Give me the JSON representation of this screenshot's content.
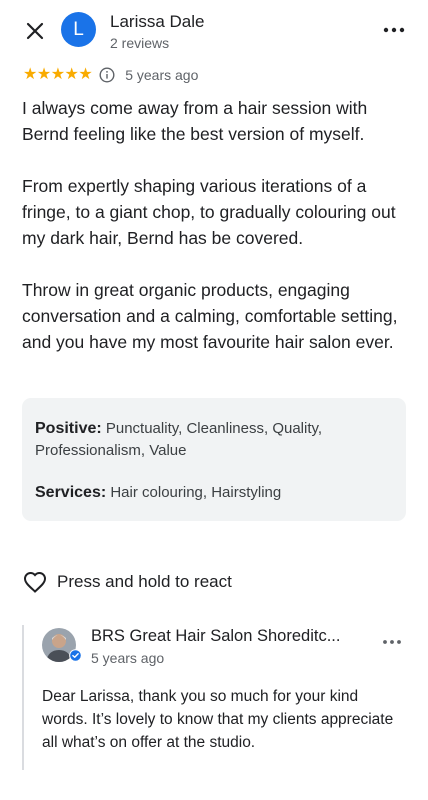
{
  "header": {
    "avatar_letter": "L",
    "reviewer_name": "Larissa Dale",
    "review_count": "2 reviews",
    "avatar_color": "#1a73e8"
  },
  "review": {
    "rating": 5,
    "stars": "★★★★★",
    "time": "5 years ago",
    "paragraphs": [
      "I always come away from a hair session with Bernd feeling like the best version of myself.",
      "From expertly shaping various iterations of a fringe, to a giant chop, to gradually colouring out my dark hair, Bernd has be covered.",
      "Throw in great organic products, engaging conversation and a calming, comfortable setting, and you have my most favourite hair salon ever."
    ]
  },
  "tags": {
    "positive_label": "Positive:",
    "positive_value": "Punctuality, Cleanliness, Quality, Professionalism, Value",
    "services_label": "Services:",
    "services_value": "Hair colouring, Hairstyling"
  },
  "react": {
    "label": "Press and hold to react"
  },
  "owner_reply": {
    "name": "BRS Great Hair Salon Shoreditc...",
    "time": "5 years ago",
    "text": "Dear Larissa, thank you so much for your kind words. It’s lovely to know that my clients appreciate all what’s on offer at the studio."
  },
  "colors": {
    "star": "#f9ab00",
    "tag_background": "#f1f3f4",
    "verified_badge": "#1a73e8"
  },
  "icons": {
    "close": "close-icon",
    "more": "more-horizontal-icon",
    "info": "info-icon",
    "heart": "heart-outline-icon",
    "verified": "verified-badge-icon"
  }
}
